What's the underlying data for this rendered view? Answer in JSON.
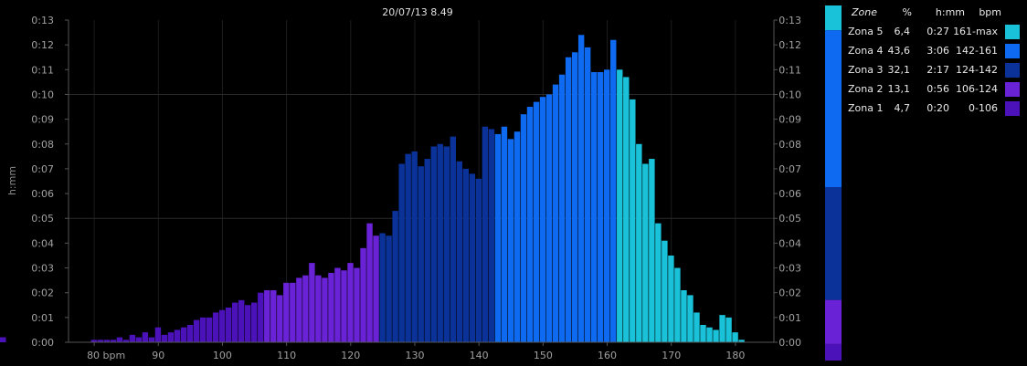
{
  "chart_data": {
    "type": "bar",
    "title": "20/07/13 8.49",
    "ylabel": "h:mm",
    "xlabel": "",
    "xlim": [
      76,
      186
    ],
    "ylim": [
      0,
      0.13
    ],
    "x_ticks": [
      {
        "v": 80,
        "label": "80 bpm"
      },
      {
        "v": 90,
        "label": "90"
      },
      {
        "v": 100,
        "label": "100"
      },
      {
        "v": 110,
        "label": "110"
      },
      {
        "v": 120,
        "label": "120"
      },
      {
        "v": 130,
        "label": "130"
      },
      {
        "v": 140,
        "label": "140"
      },
      {
        "v": 150,
        "label": "150"
      },
      {
        "v": 160,
        "label": "160"
      },
      {
        "v": 170,
        "label": "170"
      },
      {
        "v": 180,
        "label": "180"
      }
    ],
    "y_ticks": [
      "0:00",
      "0:01",
      "0:02",
      "0:03",
      "0:04",
      "0:05",
      "0:06",
      "0:07",
      "0:08",
      "0:09",
      "0:10",
      "0:11",
      "0:12",
      "0:13"
    ],
    "grid": true,
    "bpm": [
      80,
      81,
      82,
      83,
      84,
      85,
      86,
      87,
      88,
      89,
      90,
      91,
      92,
      93,
      94,
      95,
      96,
      97,
      98,
      99,
      100,
      101,
      102,
      103,
      104,
      105,
      106,
      107,
      108,
      109,
      110,
      111,
      112,
      113,
      114,
      115,
      116,
      117,
      118,
      119,
      120,
      121,
      122,
      123,
      124,
      125,
      126,
      127,
      128,
      129,
      130,
      131,
      132,
      133,
      134,
      135,
      136,
      137,
      138,
      139,
      140,
      141,
      142,
      143,
      144,
      145,
      146,
      147,
      148,
      149,
      150,
      151,
      152,
      153,
      154,
      155,
      156,
      157,
      158,
      159,
      160,
      161,
      162,
      163,
      164,
      165,
      166,
      167,
      168,
      169,
      170,
      171,
      172,
      173,
      174,
      175,
      176,
      177,
      178,
      179,
      180,
      181
    ],
    "values": [
      0.001,
      0.001,
      0.001,
      0.001,
      0.002,
      0.001,
      0.003,
      0.002,
      0.004,
      0.002,
      0.006,
      0.003,
      0.004,
      0.005,
      0.006,
      0.007,
      0.009,
      0.01,
      0.01,
      0.012,
      0.013,
      0.014,
      0.016,
      0.017,
      0.015,
      0.016,
      0.02,
      0.021,
      0.021,
      0.019,
      0.024,
      0.024,
      0.026,
      0.027,
      0.032,
      0.027,
      0.026,
      0.028,
      0.03,
      0.029,
      0.032,
      0.03,
      0.038,
      0.048,
      0.043,
      0.044,
      0.043,
      0.053,
      0.072,
      0.076,
      0.077,
      0.071,
      0.074,
      0.079,
      0.08,
      0.079,
      0.083,
      0.073,
      0.07,
      0.068,
      0.066,
      0.087,
      0.086,
      0.084,
      0.087,
      0.082,
      0.085,
      0.092,
      0.095,
      0.097,
      0.099,
      0.1,
      0.104,
      0.108,
      0.115,
      0.117,
      0.124,
      0.119,
      0.109,
      0.109,
      0.11,
      0.122,
      0.11,
      0.107,
      0.098,
      0.08,
      0.072,
      0.074,
      0.048,
      0.041,
      0.035,
      0.03,
      0.021,
      0.019,
      0.012,
      0.007,
      0.006,
      0.005,
      0.011,
      0.01,
      0.004,
      0.001,
      0.001,
      0.001,
      0.002,
      0.001,
      0.001,
      0.001,
      0.001,
      0.002,
      0.001,
      0.001
    ],
    "zones": [
      {
        "name": "Zona 5",
        "pct": "6,4",
        "time": "0:27",
        "bpm": "161-max",
        "color": "#19c2d8",
        "min": 162
      },
      {
        "name": "Zona 4",
        "pct": "43,6",
        "time": "3:06",
        "bpm": "142-161",
        "color": "#0f6af2",
        "min": 143
      },
      {
        "name": "Zona 3",
        "pct": "32,1",
        "time": "2:17",
        "bpm": "124-142",
        "color": "#0a3299",
        "min": 125
      },
      {
        "name": "Zona 2",
        "pct": "13,1",
        "time": "0:56",
        "bpm": "106-124",
        "color": "#6a22d6",
        "min": 107
      },
      {
        "name": "Zona 1",
        "pct": "4,7",
        "time": "0:20",
        "bpm": "0-106",
        "color": "#4a12b8",
        "min": 0
      }
    ],
    "zone_bar_fractions": [
      0.09,
      0.57,
      0.41,
      0.16,
      0.06
    ]
  },
  "legend": {
    "header": {
      "zone": "Zone",
      "pct": "%",
      "time": "h:mm",
      "bpm": "bpm"
    },
    "rows": [
      {
        "name": "Zona 5",
        "pct": "6,4",
        "time": "0:27",
        "bpm": "161-max",
        "color": "#19c2d8"
      },
      {
        "name": "Zona 4",
        "pct": "43,6",
        "time": "3:06",
        "bpm": "142-161",
        "color": "#0f6af2"
      },
      {
        "name": "Zona 3",
        "pct": "32,1",
        "time": "2:17",
        "bpm": "124-142",
        "color": "#0a3299"
      },
      {
        "name": "Zona 2",
        "pct": "13,1",
        "time": "0:56",
        "bpm": "106-124",
        "color": "#6a22d6"
      },
      {
        "name": "Zona 1",
        "pct": "4,7",
        "time": "0:20",
        "bpm": "0-106",
        "color": "#4a12b8"
      }
    ]
  }
}
